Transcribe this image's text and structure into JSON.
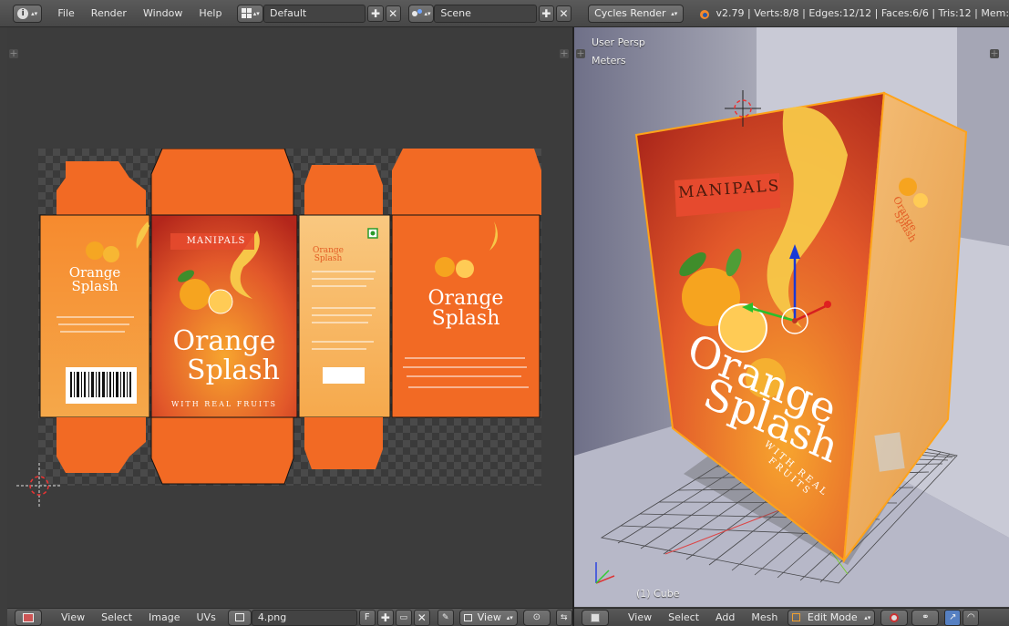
{
  "topbar": {
    "menus": [
      "File",
      "Render",
      "Window",
      "Help"
    ],
    "layout": "Default",
    "scene": "Scene",
    "engine": "Cycles Render",
    "stats": "v2.79 | Verts:8/8 | Edges:12/12 | Faces:6/6 | Tris:12 | Mem:"
  },
  "uv_editor": {
    "menus": [
      "View",
      "Select",
      "Image",
      "UVs"
    ],
    "image_name": "4.png",
    "fake_user": "F",
    "view_label": "View"
  },
  "view3d": {
    "perspective": "User Persp",
    "units": "Meters",
    "object_info": "(1) Cube",
    "menus": [
      "View",
      "Select",
      "Add",
      "Mesh"
    ],
    "mode": "Edit Mode"
  },
  "packaging": {
    "brand": "MANIPALS",
    "product_line1": "Orange",
    "product_line2": "Splash",
    "tagline": "WITH REAL FRUITS"
  },
  "colors": {
    "orange": "#f26a24",
    "deep_red": "#b8271a",
    "selection": "#ffa31a"
  }
}
